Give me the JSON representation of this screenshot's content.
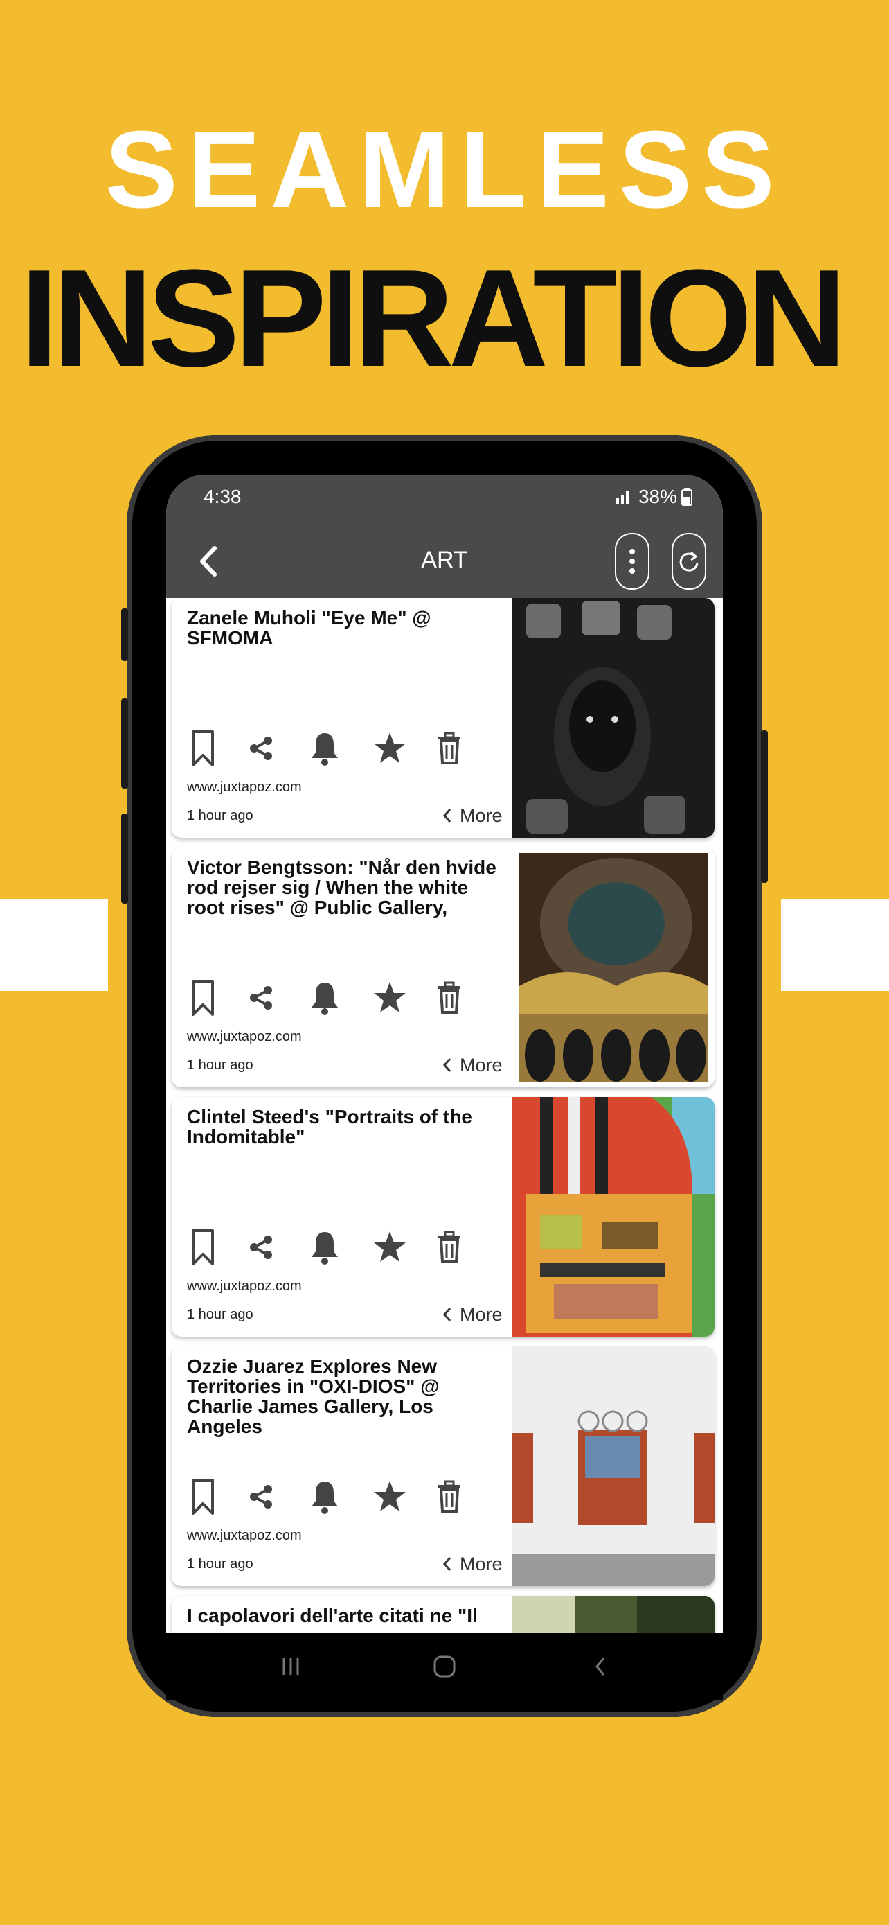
{
  "promo": {
    "line1": "SEAMLESS",
    "line2": "INSPIRATION"
  },
  "status_bar": {
    "time": "4:38",
    "battery": "38%"
  },
  "app_bar": {
    "title": "ART",
    "back_icon": "chevron-left-icon",
    "menu_icon": "more-vertical-icon",
    "refresh_icon": "refresh-icon"
  },
  "feed": {
    "items": [
      {
        "title": "Zanele Muholi \"Eye Me\" @ SFMOMA",
        "domain": "www.juxtapoz.com",
        "time": "1 hour ago",
        "more": "More",
        "thumb_colors": [
          "#1b1b1b",
          "#6b6b6b",
          "#d8d8d8"
        ]
      },
      {
        "title": "Victor Bengtsson: \"Når den hvide rod rejser sig / When the white root rises\" @ Public Gallery,",
        "domain": "www.juxtapoz.com",
        "time": "1 hour ago",
        "more": "More",
        "thumb_colors": [
          "#3b2a1c",
          "#c9a64a",
          "#1a1a1a"
        ]
      },
      {
        "title": "Clintel Steed's \"Portraits of the Indomitable\"",
        "domain": "www.juxtapoz.com",
        "time": "1 hour ago",
        "more": "More",
        "thumb_colors": [
          "#d9472e",
          "#e8a23a",
          "#5aa54a"
        ]
      },
      {
        "title": "Ozzie Juarez Explores New Territories in \"OXI-DIOS\" @ Charlie James Gallery, Los Angeles",
        "domain": "www.juxtapoz.com",
        "time": "1 hour ago",
        "more": "More",
        "thumb_colors": [
          "#eeeeee",
          "#b14a2a",
          "#9a9a9a"
        ]
      },
      {
        "title": "I capolavori dell'arte citati ne \"Il",
        "domain": "",
        "time": "",
        "more": "",
        "thumb_colors": [
          "#d0d4b0",
          "#4a5a30",
          "#2a3a20"
        ]
      }
    ]
  },
  "card_action_icons": [
    "bookmark-icon",
    "share-icon",
    "bell-icon",
    "star-icon",
    "trash-icon"
  ],
  "system_nav": [
    "recents-icon",
    "home-icon",
    "back-icon"
  ],
  "colors": {
    "background": "#F2BC2E",
    "headline_white": "#FFFFFF",
    "headline_black": "#0F0F0F",
    "app_bar": "#4A4A4A",
    "icon": "#444444"
  }
}
